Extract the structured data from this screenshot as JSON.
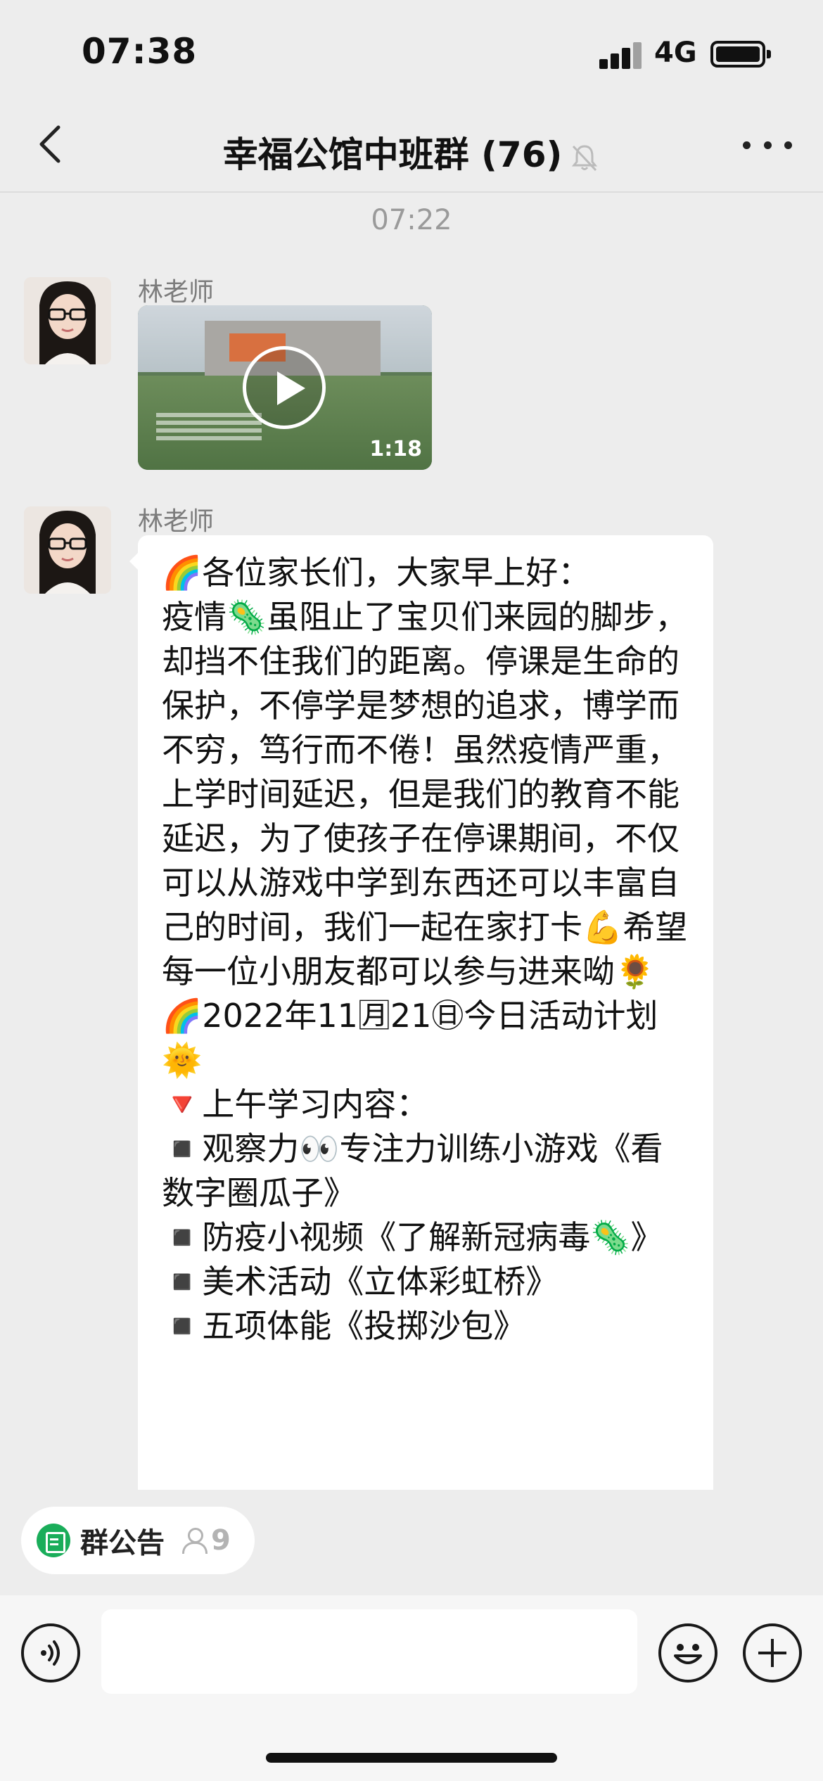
{
  "status_bar": {
    "time": "07:38",
    "network": "4G"
  },
  "nav": {
    "title": "幸福公馆中班群 (76)",
    "icons": [
      "back-arrow-icon",
      "mute-bell-icon",
      "more-icon"
    ]
  },
  "chat": {
    "timestamp": "07:22",
    "messages": [
      {
        "sender": "林老师",
        "type": "video",
        "duration": "1:18"
      },
      {
        "sender": "林老师",
        "type": "text",
        "text": "🌈各位家长们，大家早上好：\n疫情🦠虽阻止了宝贝们来园的脚步，却挡不住我们的距离。停课是生命的保护，不停学是梦想的追求，博学而不穷，笃行而不倦！虽然疫情严重，上学时间延迟，但是我们的教育不能延迟，为了使孩子在停课期间，不仅可以从游戏中学到东西还可以丰富自己的时间，我们一起在家打卡💪希望每一位小朋友都可以参与进来呦🌻\n🌈2022年11🈷21㊐今日活动计划🌞\n🔻上午学习内容：\n◾️观察力👀专注力训练小游戏《看数字圈瓜子》\n◾️防疫小视频《了解新冠病毒🦠》\n◾️美术活动《立体彩虹桥》\n◾️五项体能《投掷沙包》"
      }
    ]
  },
  "notice": {
    "label": "群公告",
    "count": "9"
  },
  "input_bar": {
    "placeholder": ""
  },
  "colors": {
    "background": "#ededed",
    "bubble": "#ffffff",
    "notice_icon": "#1aad5a"
  }
}
